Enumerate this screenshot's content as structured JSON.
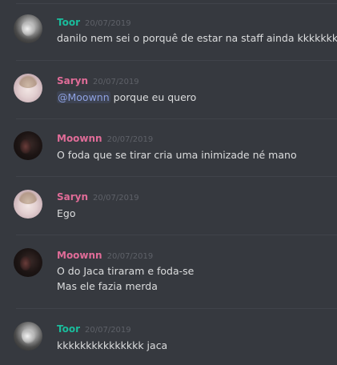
{
  "colors": {
    "background": "#36393f",
    "text": "#dcddde",
    "timestamp": "#5e6168",
    "mention": "#8ea1e1",
    "toor": "#1abc9c",
    "saryn": "#e06c98",
    "moownn": "#e06c98"
  },
  "messages": [
    {
      "author": "Toor",
      "timestamp": "20/07/2019",
      "avatar_icon": "wolf-avatar-icon",
      "lines": [
        "danilo nem sei o porquê de estar na staff ainda kkkkkkkk"
      ]
    },
    {
      "author": "Saryn",
      "timestamp": "20/07/2019",
      "avatar_icon": "girl-avatar-icon",
      "mention": "@Moownn",
      "lines": [
        " porque eu quero"
      ]
    },
    {
      "author": "Moownn",
      "timestamp": "20/07/2019",
      "avatar_icon": "dark-avatar-icon",
      "lines": [
        "O foda que se tirar cria uma inimizade né mano"
      ]
    },
    {
      "author": "Saryn",
      "timestamp": "20/07/2019",
      "avatar_icon": "girl-avatar-icon",
      "lines": [
        "Ego"
      ]
    },
    {
      "author": "Moownn",
      "timestamp": "20/07/2019",
      "avatar_icon": "dark-avatar-icon",
      "lines": [
        "O do Jaca tiraram e foda-se",
        "Mas ele fazia merda"
      ]
    },
    {
      "author": "Toor",
      "timestamp": "20/07/2019",
      "avatar_icon": "wolf-avatar-icon",
      "lines": [
        "kkkkkkkkkkkkkkk jaca"
      ]
    }
  ]
}
